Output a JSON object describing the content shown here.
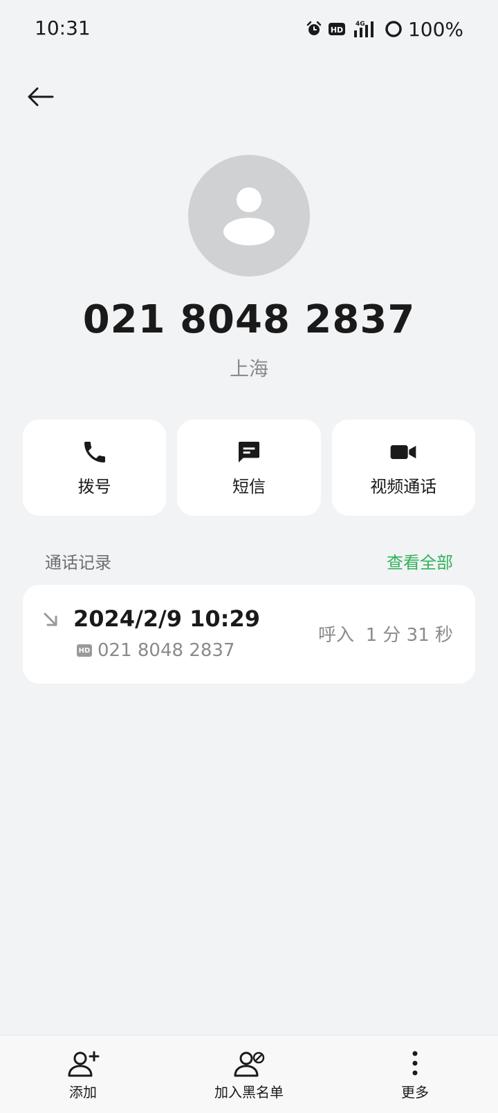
{
  "status_bar": {
    "time": "10:31",
    "battery": "100%",
    "icons": [
      "alarm-icon",
      "hd-icon",
      "signal-4g-icon",
      "battery-icon"
    ]
  },
  "contact": {
    "number": "021 8048 2837",
    "location": "上海"
  },
  "actions": {
    "dial_label": "拨号",
    "sms_label": "短信",
    "video_label": "视频通话"
  },
  "call_log": {
    "title": "通话记录",
    "view_all": "查看全部",
    "entries": [
      {
        "datetime": "2024/2/9 10:29",
        "hd_badge": "HD",
        "number": "021 8048 2837",
        "info": "呼入  1 分 31 秒"
      }
    ]
  },
  "bottom_bar": {
    "add_label": "添加",
    "block_label": "加入黑名单",
    "more_label": "更多"
  },
  "colors": {
    "background": "#f2f3f5",
    "accent_green": "#2fb35a",
    "avatar_gray": "#d0d1d3"
  }
}
